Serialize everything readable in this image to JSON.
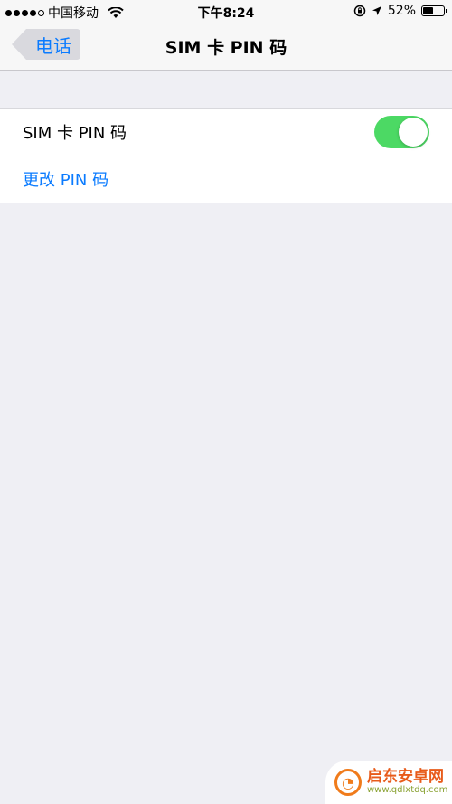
{
  "status_bar": {
    "carrier": "中国移动",
    "time": "下午8:24",
    "battery_percent": "52%",
    "battery_level": 0.52
  },
  "nav": {
    "back_label": "电话",
    "title": "SIM 卡 PIN 码"
  },
  "settings": {
    "sim_pin_label": "SIM 卡 PIN 码",
    "sim_pin_enabled": true,
    "change_pin_label": "更改 PIN 码"
  },
  "watermark": {
    "title": "启东安卓网",
    "url": "www.qdlxtdq.com"
  },
  "colors": {
    "accent": "#0a7bff",
    "toggle_on": "#4cd964",
    "background": "#efeff4"
  }
}
